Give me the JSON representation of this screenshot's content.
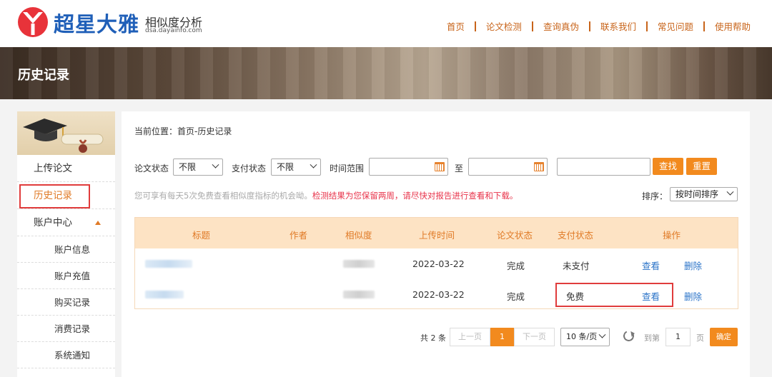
{
  "brand": {
    "name": "超星大雅",
    "subtitle": "相似度分析",
    "url": "dsa.dayainfo.com",
    "accent": "#1f5fb8",
    "logo_color": "#e8333a"
  },
  "nav": {
    "items": [
      "首页",
      "论文检测",
      "查询真伪",
      "联系我们",
      "常见问题",
      "使用帮助"
    ]
  },
  "banner": {
    "title": "历史记录"
  },
  "sidebar": {
    "items": [
      {
        "label": "上传论文"
      },
      {
        "label": "历史记录"
      },
      {
        "label": "账户中心"
      },
      {
        "label": "账户信息"
      },
      {
        "label": "账户充值"
      },
      {
        "label": "购买记录"
      },
      {
        "label": "消费记录"
      },
      {
        "label": "系统通知"
      }
    ]
  },
  "breadcrumb": "当前位置：首页-历史记录",
  "filters": {
    "paper_status_label": "论文状态",
    "paper_status_value": "不限",
    "pay_status_label": "支付状态",
    "pay_status_value": "不限",
    "time_range_label": "时间范围",
    "to_label": "至",
    "search_label": "查找",
    "reset_label": "重置"
  },
  "notice": {
    "gray": "您可享有每天5次免费查看相似度指标的机会呦。",
    "red": "检测结果为您保留两周，请尽快对报告进行查看和下载。"
  },
  "sort": {
    "label": "排序：",
    "value": "按时间排序"
  },
  "table": {
    "columns": [
      "标题",
      "作者",
      "相似度",
      "上传时间",
      "论文状态",
      "支付状态",
      "操作"
    ],
    "rows": [
      {
        "date": "2022-03-22",
        "status": "完成",
        "pay": "未支付",
        "view": "查看",
        "delete": "删除"
      },
      {
        "date": "2022-03-22",
        "status": "完成",
        "pay": "免费",
        "view": "查看",
        "delete": "删除"
      }
    ]
  },
  "pager": {
    "total": "共 2 条",
    "prev": "上一页",
    "current": "1",
    "next": "下一页",
    "per_page": "10 条/页",
    "goto_label": "到第",
    "goto_value": "1",
    "page_unit": "页",
    "confirm": "确定"
  }
}
